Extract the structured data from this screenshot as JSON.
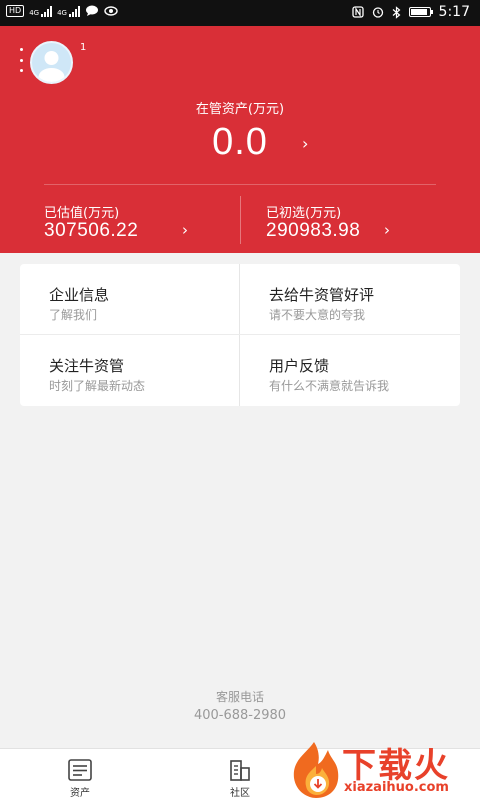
{
  "status_bar": {
    "left_tags": [
      "HD",
      "4G",
      "4G"
    ],
    "time": "5:17",
    "battery_level": 0.9
  },
  "header": {
    "avatar_badge": "1",
    "aum_label": "在管资产(万元)",
    "aum_value": "0.0",
    "stats": [
      {
        "label": "已估值(万元)",
        "value": "307506.22"
      },
      {
        "label": "已初选(万元)",
        "value": "290983.98"
      }
    ]
  },
  "menu": [
    {
      "title": "企业信息",
      "subtitle": "了解我们"
    },
    {
      "title": "去给牛资管好评",
      "subtitle": "请不要大意的夸我"
    },
    {
      "title": "关注牛资管",
      "subtitle": "时刻了解最新动态"
    },
    {
      "title": "用户反馈",
      "subtitle": "有什么不满意就告诉我"
    }
  ],
  "service": {
    "label": "客服电话",
    "phone": "400-688-2980"
  },
  "tabbar": [
    {
      "label": "资产",
      "icon": "document-icon"
    },
    {
      "label": "社区",
      "icon": "buildings-icon"
    }
  ],
  "watermark": {
    "brand": "下载火",
    "url": "xiazaihuo.com"
  },
  "colors": {
    "brand_red": "#d92f37",
    "watermark_orange": "#e8412a"
  }
}
